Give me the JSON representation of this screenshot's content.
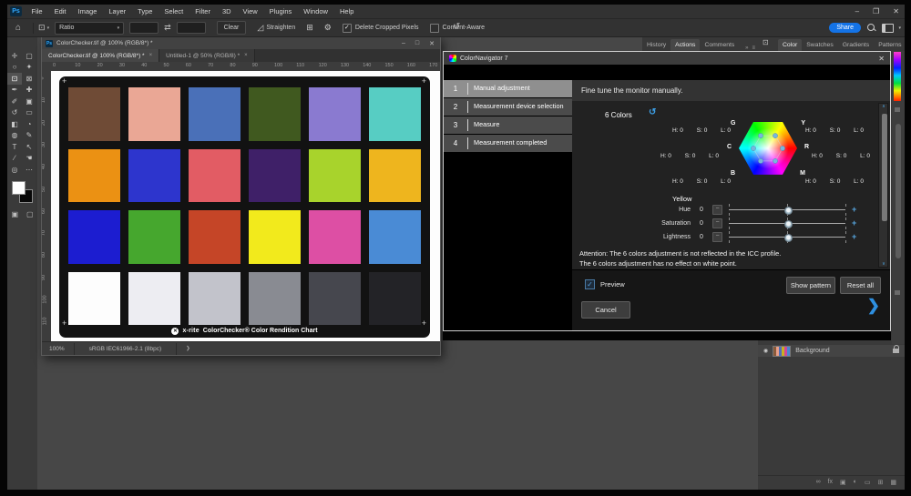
{
  "app": {
    "logo": "Ps",
    "menus": [
      "File",
      "Edit",
      "Image",
      "Layer",
      "Type",
      "Select",
      "Filter",
      "3D",
      "View",
      "Plugins",
      "Window",
      "Help"
    ],
    "window_controls": {
      "minimize": "–",
      "restore": "❐",
      "close": "✕"
    },
    "share_label": "Share"
  },
  "options_bar": {
    "home_icon": "⌂",
    "crop_tool_icon": "⊡",
    "ratio_label": "Ratio",
    "width_value": "",
    "height_value": "",
    "swap_icon": "⇄",
    "clear_label": "Clear",
    "straighten_icon": "◿",
    "straighten_label": "Straighten",
    "grid_icon": "⊞",
    "gear_icon": "⚙",
    "undo_icon": "↺",
    "delete_cropped": {
      "label": "Delete Cropped Pixels",
      "checked": true,
      "check_glyph": "✓"
    },
    "content_aware": {
      "label": "Content-Aware",
      "checked": false
    }
  },
  "toolbar": {
    "tools": [
      {
        "name": "move",
        "glyph": "✛"
      },
      {
        "name": "marquee",
        "glyph": "▢"
      },
      {
        "name": "lasso",
        "glyph": "○"
      },
      {
        "name": "quick-selection",
        "glyph": "✦"
      },
      {
        "name": "crop",
        "glyph": "⊡",
        "selected": true
      },
      {
        "name": "frame",
        "glyph": "⊠"
      },
      {
        "name": "eyedropper",
        "glyph": "✒"
      },
      {
        "name": "healing-brush",
        "glyph": "✚"
      },
      {
        "name": "brush",
        "glyph": "✐"
      },
      {
        "name": "clone-stamp",
        "glyph": "▣"
      },
      {
        "name": "history-brush",
        "glyph": "↺"
      },
      {
        "name": "eraser",
        "glyph": "▭"
      },
      {
        "name": "gradient",
        "glyph": "◧"
      },
      {
        "name": "blur",
        "glyph": "◔"
      },
      {
        "name": "dodge",
        "glyph": "◍"
      },
      {
        "name": "pen",
        "glyph": "✎"
      },
      {
        "name": "type",
        "glyph": "T"
      },
      {
        "name": "path-selection",
        "glyph": "↖"
      },
      {
        "name": "shape",
        "glyph": "∕"
      },
      {
        "name": "hand",
        "glyph": "☚"
      },
      {
        "name": "zoom",
        "glyph": "◎"
      },
      {
        "name": "edit-toolbar",
        "glyph": "⋯"
      }
    ],
    "mode_icons": [
      {
        "name": "quick-mask",
        "glyph": "▣"
      },
      {
        "name": "screen-mode",
        "glyph": "▢"
      }
    ]
  },
  "document_window": {
    "title": "ColorChecker.tif @ 100% (RGB/8*) *",
    "controls": {
      "minimize": "–",
      "maximize": "□",
      "close": "✕"
    },
    "tabs": [
      {
        "label": "ColorChecker.tif @ 100% (RGB/8*) *",
        "close": "×",
        "active": true
      },
      {
        "label": "Untitled-1 @ 50% (RGB/8) *",
        "close": "×",
        "active": false
      }
    ],
    "ruler_h": [
      "0",
      "10",
      "20",
      "30",
      "40",
      "50",
      "60",
      "70",
      "80",
      "90",
      "100",
      "110",
      "120",
      "130",
      "140",
      "150",
      "160",
      "170"
    ],
    "ruler_v": [
      "0",
      "10",
      "20",
      "30",
      "40",
      "50",
      "60",
      "70",
      "80",
      "90",
      "100",
      "110"
    ],
    "status": {
      "zoom": "100%",
      "profile": "sRGB IEC61966-2.1 (8bpc)",
      "chevron": "❯"
    },
    "chart_caption": {
      "logo_glyph": "✕",
      "brand": "x-rite",
      "title": "ColorChecker® Color Rendition Chart"
    },
    "reg_mark": "+"
  },
  "color_checker": {
    "rows": [
      [
        "#6f4b36",
        "#eaa795",
        "#4a70b8",
        "#40591f",
        "#8a7ad0",
        "#57cdc3"
      ],
      [
        "#eb9113",
        "#2d35cd",
        "#e25c64",
        "#3f2068",
        "#a8d32c",
        "#eeb51e"
      ],
      [
        "#1c1dd0",
        "#46a72e",
        "#c54527",
        "#f2ea1c",
        "#dd4fa4",
        "#4a8bd5"
      ],
      [
        "#fdfdfd",
        "#ededf2",
        "#c2c3cb",
        "#898b92",
        "#46474e",
        "#232327"
      ]
    ]
  },
  "panels": {
    "left_group_tabs": [
      {
        "label": "History",
        "active": false
      },
      {
        "label": "Actions",
        "active": true
      },
      {
        "label": "Comments",
        "active": false
      }
    ],
    "left_group_extra": {
      "expand": "»",
      "menu": "≡"
    },
    "right_group_tabs": [
      {
        "label": "Color",
        "active": true
      },
      {
        "label": "Swatches",
        "active": false
      },
      {
        "label": "Gradients",
        "active": false
      },
      {
        "label": "Patterns",
        "active": false
      }
    ],
    "right_group_menu": "≡",
    "collapsed_dock_icon": "⊡",
    "layers": {
      "eye_icon": "◉",
      "layer_name": "Background",
      "footer_icons": [
        {
          "name": "link-layers",
          "glyph": "∞"
        },
        {
          "name": "layer-effects",
          "glyph": "fx"
        },
        {
          "name": "layer-mask",
          "glyph": "▣"
        },
        {
          "name": "adjustment-layer",
          "glyph": "◐"
        },
        {
          "name": "layer-group",
          "glyph": "▭"
        },
        {
          "name": "new-layer",
          "glyph": "⊞"
        },
        {
          "name": "delete-layer",
          "glyph": "▦"
        }
      ]
    }
  },
  "dialog": {
    "title": "ColorNavigator 7",
    "close": "✕",
    "steps": [
      {
        "num": "1",
        "label": "Manual adjustment",
        "active": true
      },
      {
        "num": "2",
        "label": "Measurement device selection",
        "active": false
      },
      {
        "num": "3",
        "label": "Measure",
        "active": false
      },
      {
        "num": "4",
        "label": "Measurement completed",
        "active": false
      }
    ],
    "description": "Fine tune the monitor manually.",
    "six_colors_label": "6 Colors",
    "undo_icon": "↺",
    "hex_points": [
      {
        "letter": "G",
        "h": "H: 0",
        "s": "S: 0",
        "l": "L: 0"
      },
      {
        "letter": "Y",
        "h": "H: 0",
        "s": "S: 0",
        "l": "L: 0"
      },
      {
        "letter": "C",
        "h": "H: 0",
        "s": "S: 0",
        "l": "L: 0"
      },
      {
        "letter": "R",
        "h": "H: 0",
        "s": "S: 0",
        "l": "L: 0"
      },
      {
        "letter": "B",
        "h": "H: 0",
        "s": "S: 0",
        "l": "L: 0"
      },
      {
        "letter": "M",
        "h": "H: 0",
        "s": "S: 0",
        "l": "L: 0"
      }
    ],
    "adjust_color_label": "Yellow",
    "sliders": [
      {
        "label": "Hue",
        "value": "0"
      },
      {
        "label": "Saturation",
        "value": "0"
      },
      {
        "label": "Lightness",
        "value": "0"
      }
    ],
    "minus_glyph": "−",
    "plus_glyph": "+",
    "attention_lines": [
      "Attention: The 6 colors adjustment is not reflected in the ICC profile.",
      "The 6 colors adjustment has no effect on white point."
    ],
    "scroll_up_glyph": "∧",
    "scroll_down_glyph": "∨",
    "preview": {
      "label": "Preview",
      "checked": true,
      "check_glyph": "✓"
    },
    "show_pattern_label": "Show pattern",
    "reset_all_label": "Reset all",
    "cancel_label": "Cancel",
    "next_arrow": "❯",
    "accent_color": "#2e8fe0"
  }
}
